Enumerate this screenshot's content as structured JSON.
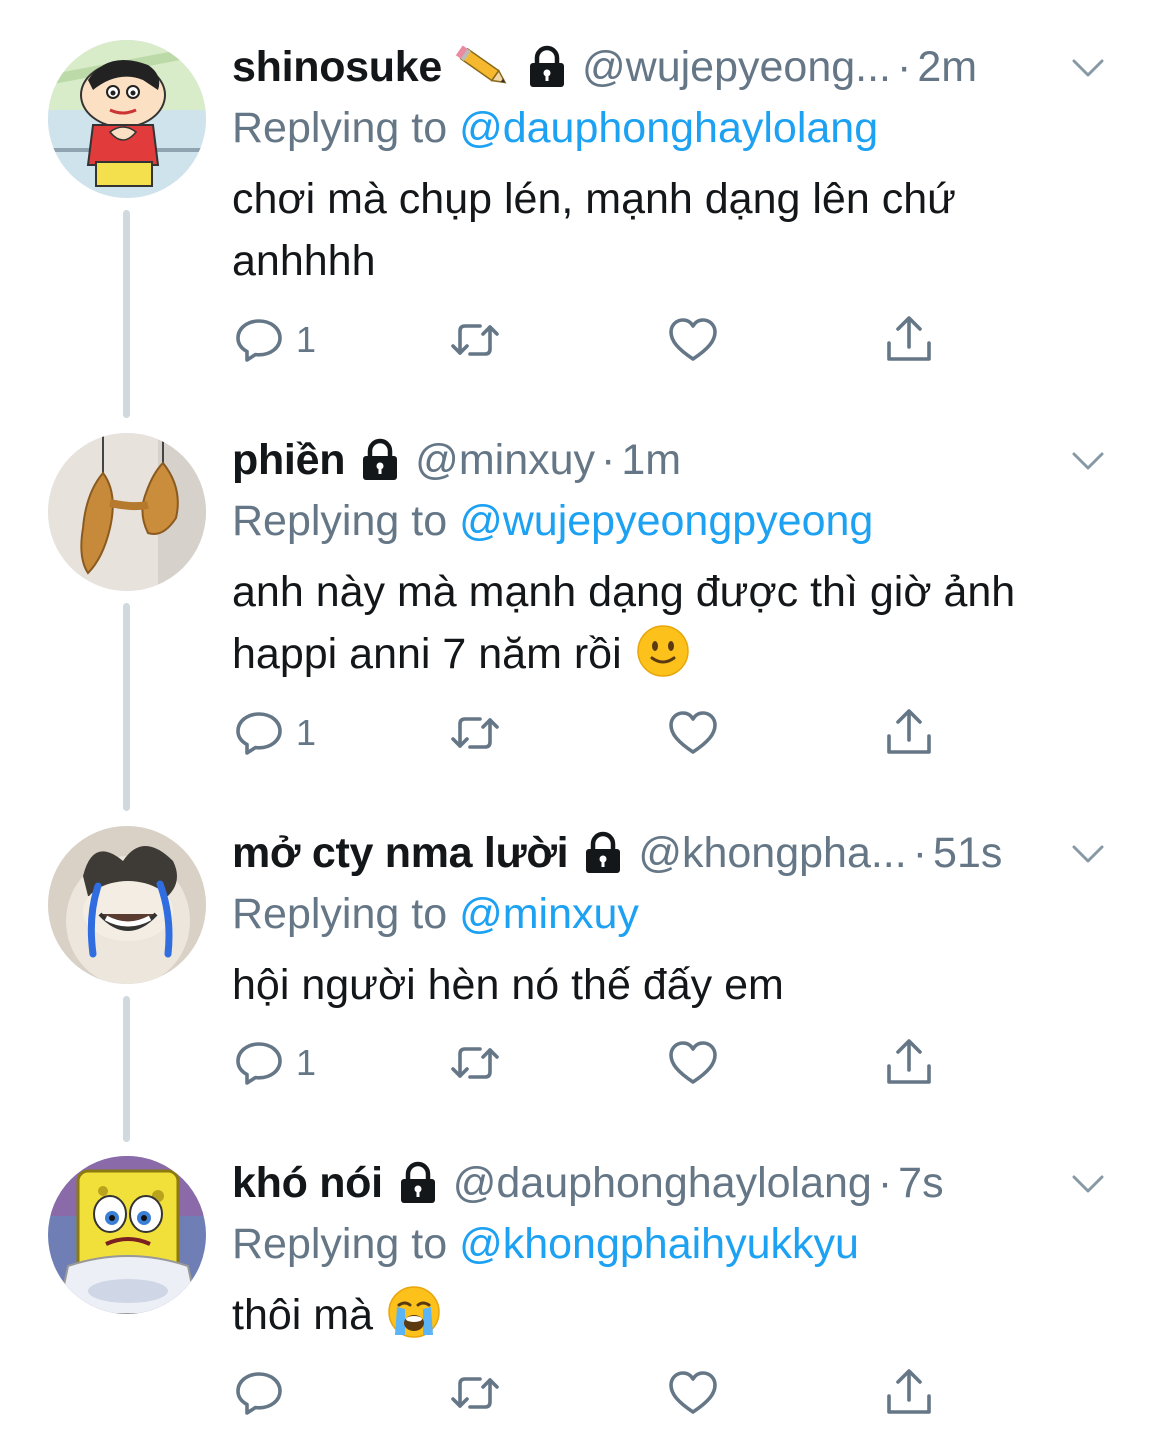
{
  "colors": {
    "link": "#1da1f2",
    "secondary_text": "#657786",
    "primary_text": "#14171a",
    "thread_line": "#cfd9de"
  },
  "tweets": [
    {
      "display_name": "shinosuke",
      "name_emoji": "pencil-emoji",
      "locked": true,
      "handle": "@wujepyeong...",
      "separator": "·",
      "time": "2m",
      "replying_label": "Replying to ",
      "replying_to": "@dauphonghaylolang",
      "text": "chơi mà chụp lén, mạnh dạng lên chứ anhhhh",
      "reply_count": "1",
      "avatar_icon": "cartoon-boy-avatar"
    },
    {
      "display_name": "phiền",
      "locked": true,
      "handle": "@minxuy",
      "separator": "·",
      "time": "1m",
      "replying_label": "Replying to ",
      "replying_to": "@wujepyeongpyeong",
      "text": "anh này mà mạnh dạng được thì giờ ảnh happi anni 7 năm rồi",
      "text_emoji": "slightly-smiling-face-emoji",
      "reply_count": "1",
      "avatar_icon": "hanging-chickens-avatar"
    },
    {
      "display_name": "mở cty nma lười",
      "locked": true,
      "handle": "@khongpha...",
      "separator": "·",
      "time": "51s",
      "replying_label": "Replying to ",
      "replying_to": "@minxuy",
      "text": "hội người hèn nó thế đấy em",
      "reply_count": "1",
      "avatar_icon": "crying-cat-avatar"
    },
    {
      "display_name": "khó nói",
      "locked": true,
      "handle": "@dauphonghaylolang",
      "separator": "·",
      "time": "7s",
      "replying_label": "Replying to ",
      "replying_to": "@khongphaihyukkyu",
      "text": "thôi mà",
      "text_emoji": "loudly-crying-face-emoji",
      "reply_count": "",
      "avatar_icon": "crying-sponge-avatar"
    }
  ]
}
